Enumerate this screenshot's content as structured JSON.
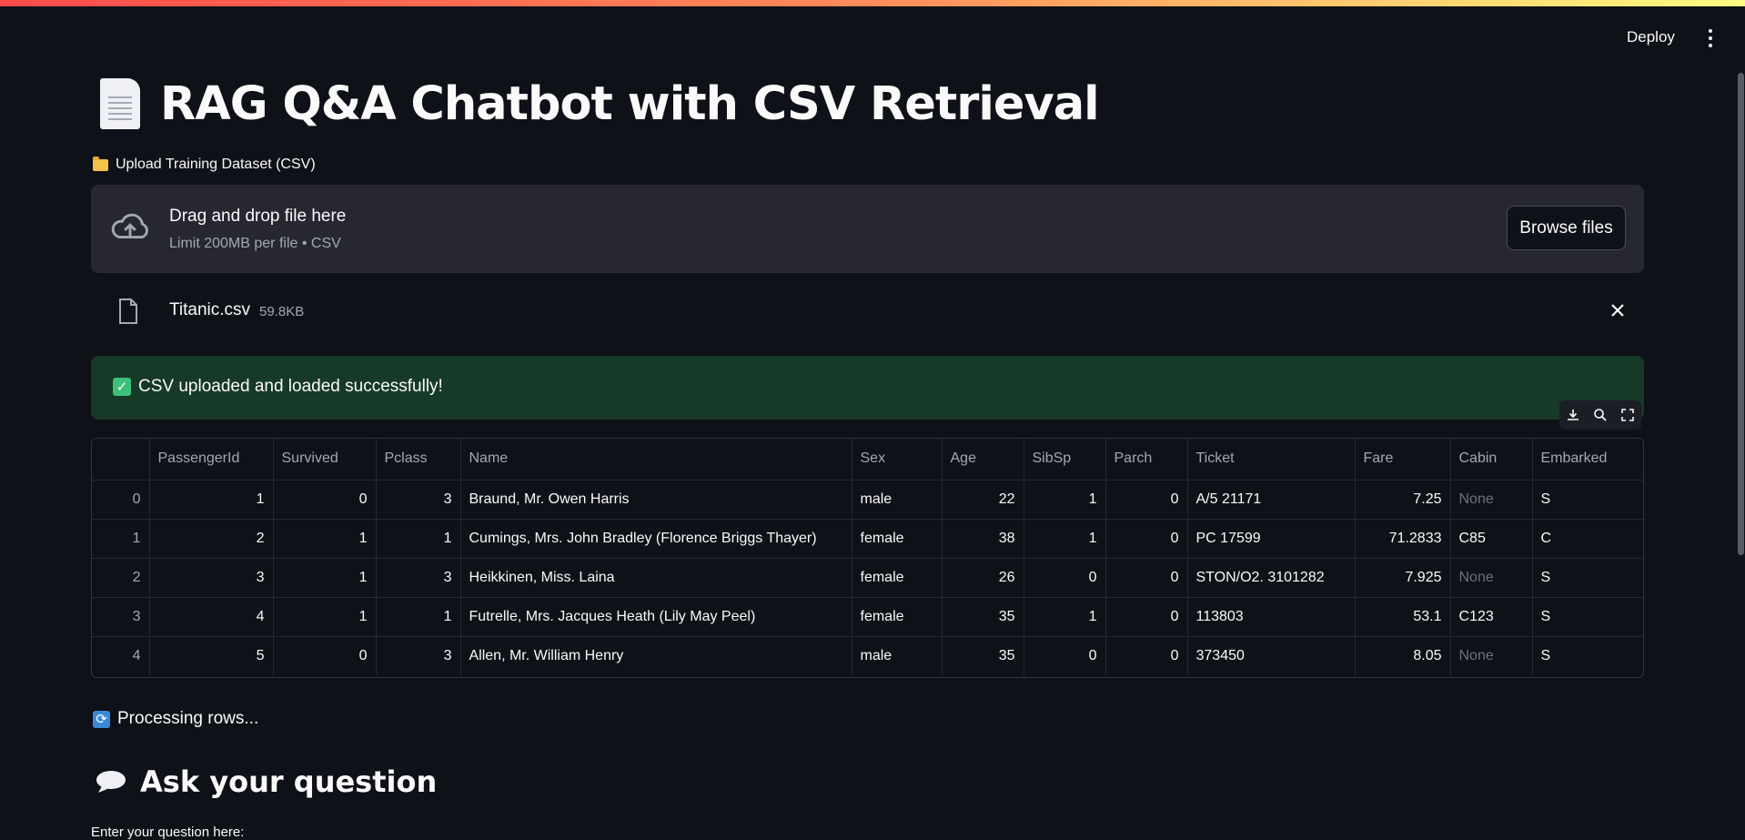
{
  "header": {
    "deploy_label": "Deploy",
    "menu_icon": "more-vertical-icon"
  },
  "page": {
    "title": "RAG Q&A Chatbot with CSV Retrieval",
    "title_icon": "document-icon"
  },
  "uploader": {
    "label": "Upload Training Dataset (CSV)",
    "label_icon": "folder-icon",
    "drop_text": "Drag and drop file here",
    "limit_text": "Limit 200MB per file • CSV",
    "browse_label": "Browse files",
    "file": {
      "name": "Titanic.csv",
      "size": "59.8KB"
    }
  },
  "success": {
    "message": "CSV uploaded and loaded successfully!",
    "icon": "check-box-icon",
    "color": "#173928"
  },
  "dataframe": {
    "columns": [
      "",
      "PassengerId",
      "Survived",
      "Pclass",
      "Name",
      "Sex",
      "Age",
      "SibSp",
      "Parch",
      "Ticket",
      "Fare",
      "Cabin",
      "Embarked"
    ],
    "rows": [
      [
        "0",
        "1",
        "0",
        "3",
        "Braund, Mr. Owen Harris",
        "male",
        "22",
        "1",
        "0",
        "A/5 21171",
        "7.25",
        "None",
        "S"
      ],
      [
        "1",
        "2",
        "1",
        "1",
        "Cumings, Mrs. John Bradley (Florence Briggs Thayer)",
        "female",
        "38",
        "1",
        "0",
        "PC 17599",
        "71.2833",
        "C85",
        "C"
      ],
      [
        "2",
        "3",
        "1",
        "3",
        "Heikkinen, Miss. Laina",
        "female",
        "26",
        "0",
        "0",
        "STON/O2. 3101282",
        "7.925",
        "None",
        "S"
      ],
      [
        "3",
        "4",
        "1",
        "1",
        "Futrelle, Mrs. Jacques Heath (Lily May Peel)",
        "female",
        "35",
        "1",
        "0",
        "113803",
        "53.1",
        "C123",
        "S"
      ],
      [
        "4",
        "5",
        "0",
        "3",
        "Allen, Mr. William Henry",
        "male",
        "35",
        "0",
        "0",
        "373450",
        "8.05",
        "None",
        "S"
      ]
    ]
  },
  "status": {
    "processing_text": "Processing rows...",
    "processing_icon": "refresh-icon"
  },
  "question": {
    "heading": "Ask your question",
    "heading_icon": "speech-bubble-icon",
    "input_label": "Enter your question here:"
  },
  "colors": {
    "background": "#0e1117",
    "surface": "#262730",
    "accent": "#ff4b4b",
    "success": "#173928"
  }
}
